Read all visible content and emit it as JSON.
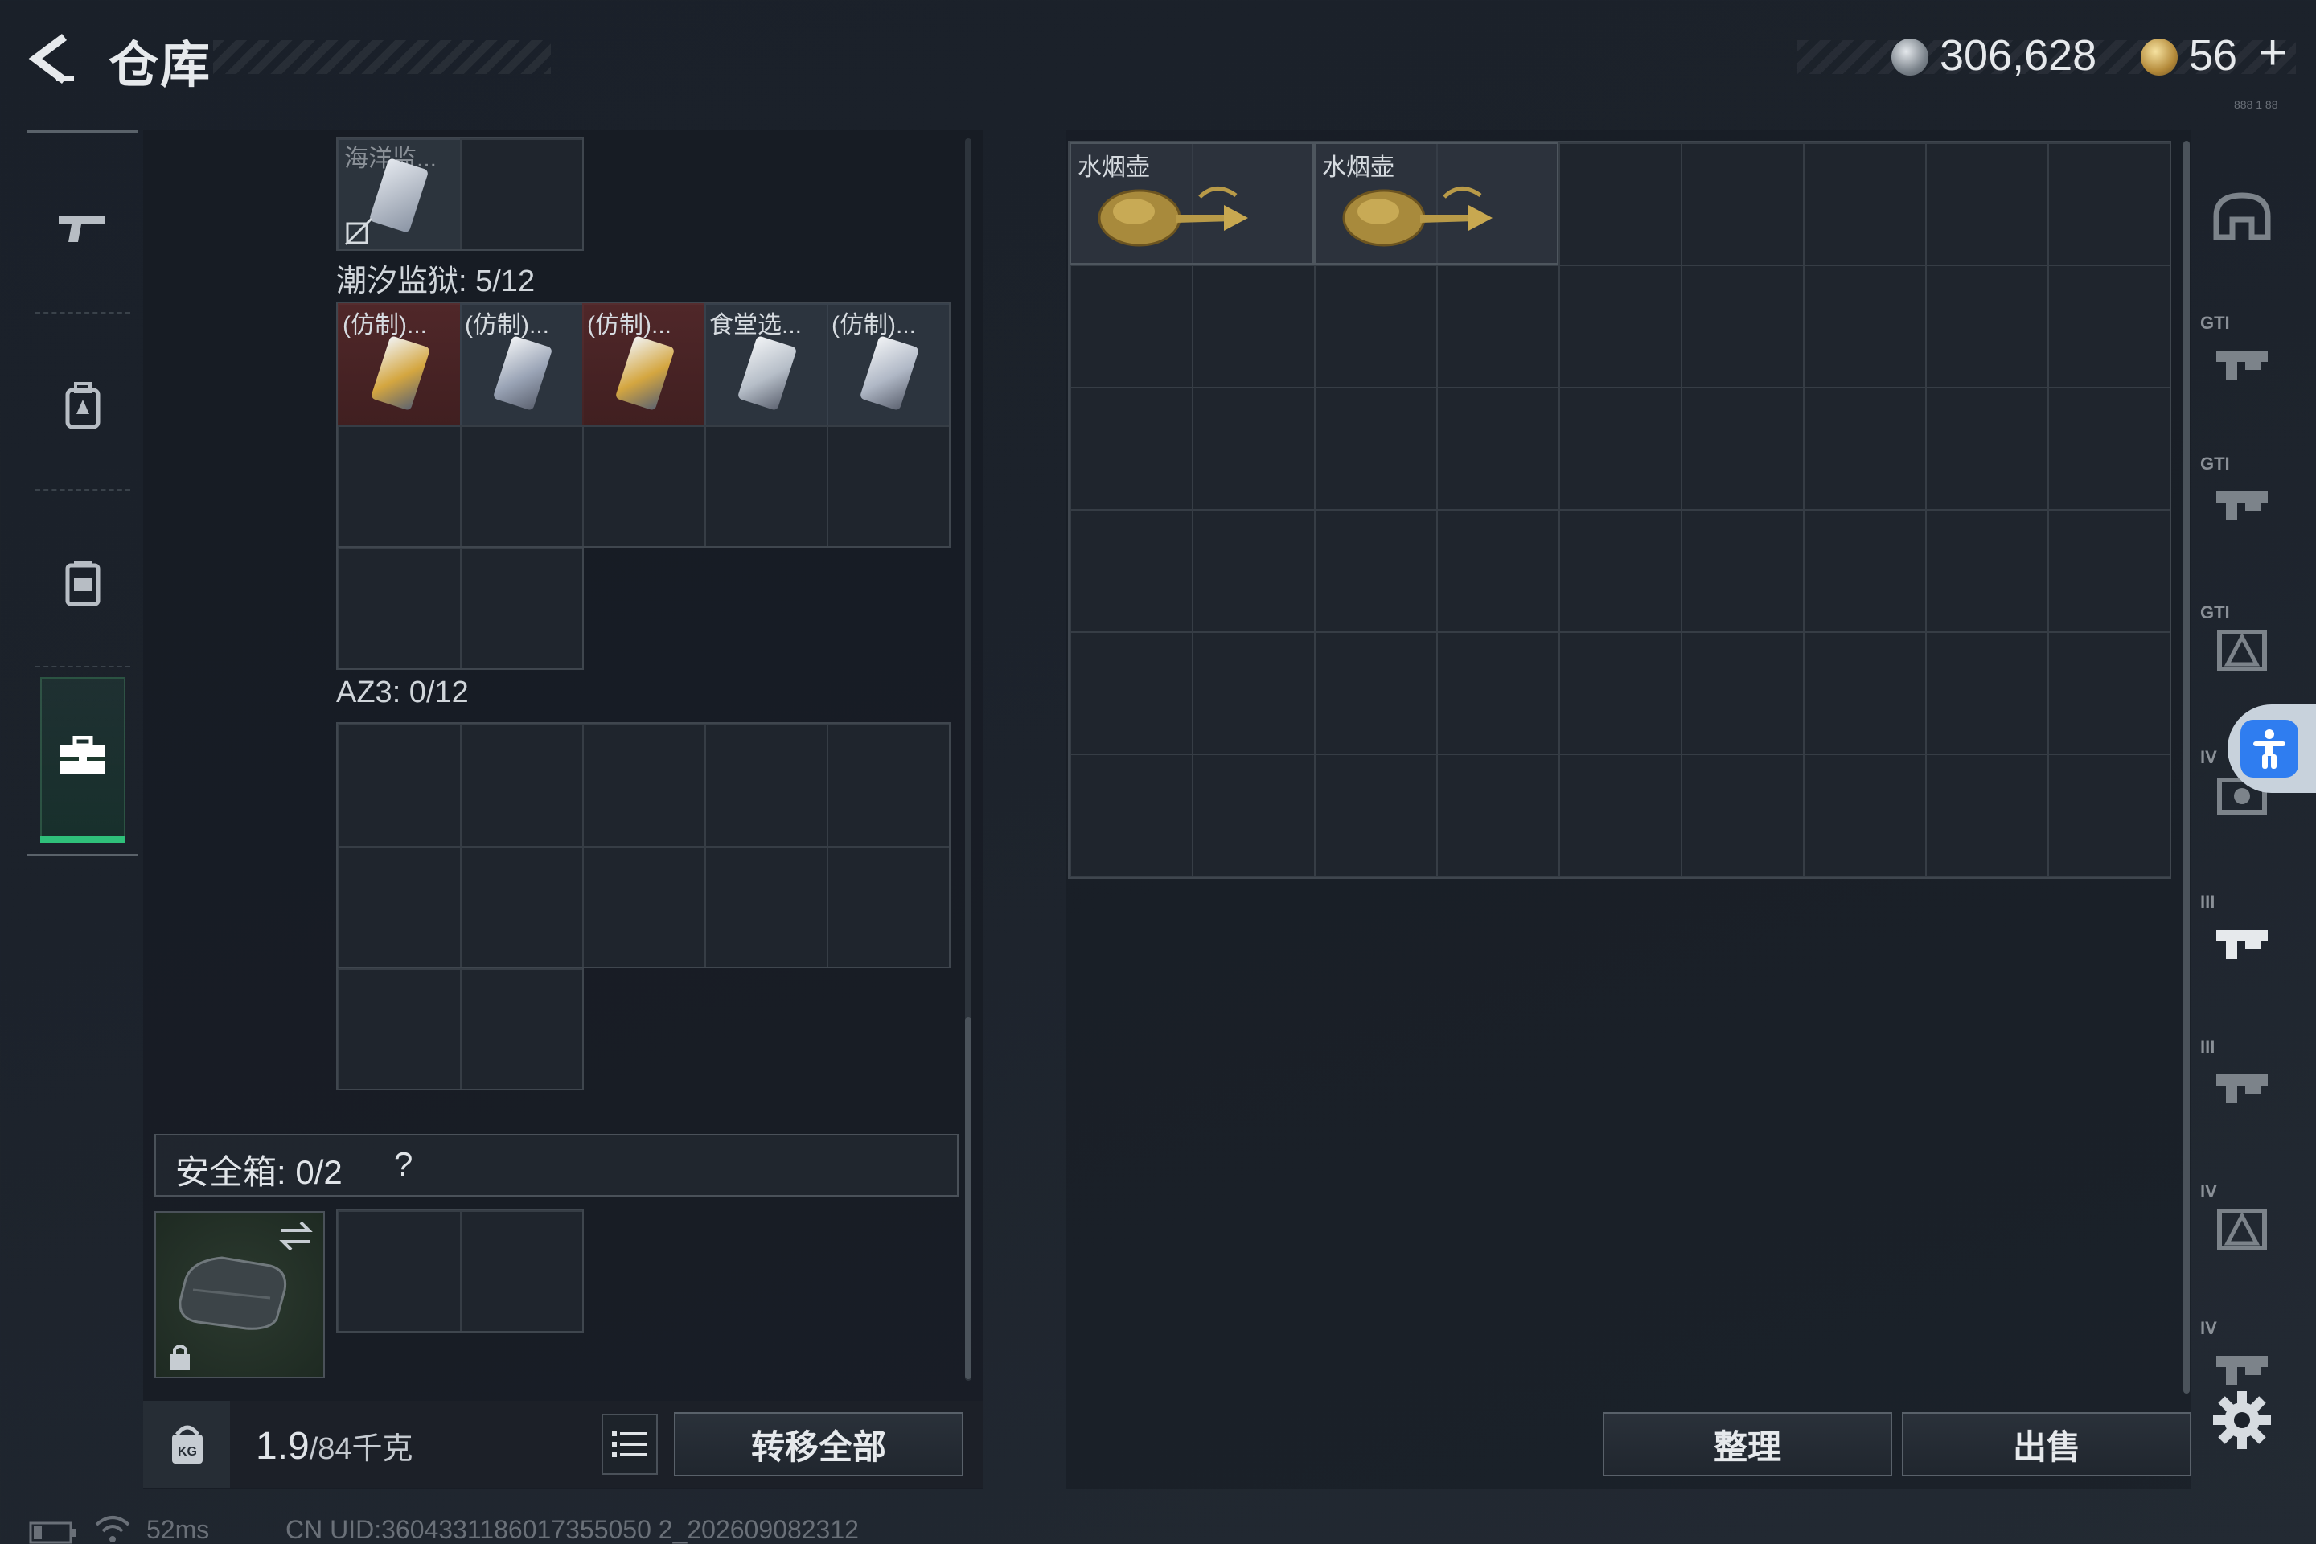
{
  "header": {
    "title": "仓库",
    "currency1": "306,628",
    "currency2": "56",
    "currency2_add": "+",
    "corner_label": "888 1 88"
  },
  "sidebar": {
    "items": [
      "weapon",
      "backpack",
      "chest-rig",
      "briefcase"
    ],
    "active": "briefcase"
  },
  "loadout": {
    "top_item_name": "海洋监...",
    "section1_label": "潮汐监狱: 5/12",
    "section1_items": [
      {
        "name": "(仿制)...",
        "color": "#d4a640"
      },
      {
        "name": "(仿制)...",
        "color": "#9aa4b6"
      },
      {
        "name": "(仿制)...",
        "color": "#d4a640"
      },
      {
        "name": "食堂选...",
        "color": "#b6bec8"
      },
      {
        "name": "(仿制)...",
        "color": "#b0b8c6"
      }
    ],
    "section2_label": "AZ3: 0/12",
    "safe_box_label": "安全箱: 0/2",
    "safe_box_help": "?",
    "weight_value": "1.9",
    "weight_max": "/84千克",
    "transfer_label": "转移全部"
  },
  "stash": {
    "items": [
      {
        "name": "水烟壶"
      },
      {
        "name": "水烟壶"
      }
    ],
    "sort_label": "整理",
    "sell_label": "出售"
  },
  "right_sidebar": {
    "items": [
      {
        "icon": "helmet-icon",
        "text": ""
      },
      {
        "icon": "gti-weapon-icon",
        "text": "GTI"
      },
      {
        "icon": "gti-weapon-ammo-icon",
        "text": "GTI"
      },
      {
        "icon": "gti-triangle-icon",
        "text": "GTI"
      },
      {
        "icon": "iv-gear-icon",
        "text": "IV"
      },
      {
        "icon": "iii-weapon-icon",
        "text": "III"
      },
      {
        "icon": "iii-weapon-2-icon",
        "text": "III"
      },
      {
        "icon": "iv-triangle-icon",
        "text": "IV"
      },
      {
        "icon": "iv-partial-icon",
        "text": "IV"
      }
    ]
  },
  "status_bar": {
    "ping": "52ms",
    "uid": "CN UID:3604331186017355050 2_202609082312"
  },
  "colors": {
    "accent_green": "#2fc07a",
    "access_blue": "#2f7df0",
    "rare_red": "#5a2a2a"
  }
}
